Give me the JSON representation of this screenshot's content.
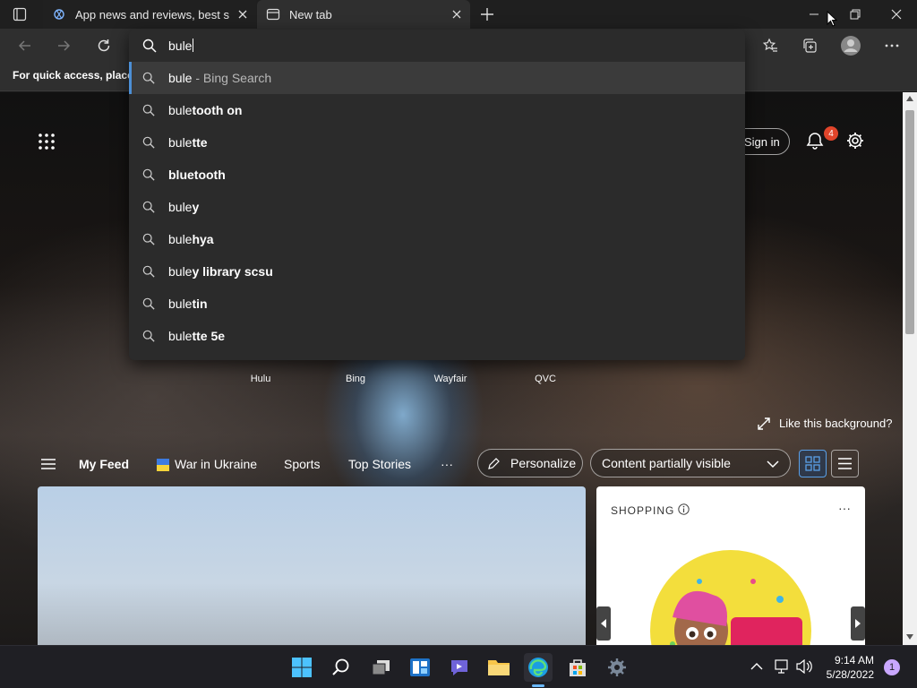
{
  "browser": {
    "tabs": [
      {
        "title": "App news and reviews, best softw",
        "active": false
      },
      {
        "title": "New tab",
        "active": true
      }
    ],
    "address_input_value": "bule",
    "favorites_hint": "For quick access, place y"
  },
  "suggestions": [
    {
      "prefix": "bule",
      "rest": "",
      "hint": " - Bing Search"
    },
    {
      "prefix": "bule",
      "rest": "tooth on",
      "hint": ""
    },
    {
      "prefix": "bule",
      "rest": "tte",
      "hint": ""
    },
    {
      "prefix": "",
      "rest": "bluetooth",
      "hint": ""
    },
    {
      "prefix": "bule",
      "rest": "y",
      "hint": ""
    },
    {
      "prefix": "bule",
      "rest": "hya",
      "hint": ""
    },
    {
      "prefix": "bule",
      "rest": "y library scsu",
      "hint": ""
    },
    {
      "prefix": "bule",
      "rest": "tin",
      "hint": ""
    },
    {
      "prefix": "bule",
      "rest": "tte 5e",
      "hint": ""
    }
  ],
  "page": {
    "sign_in": "Sign in",
    "notification_count": "4",
    "quick_links": [
      "Hulu",
      "Bing",
      "Wayfair",
      "QVC"
    ],
    "like_background": "Like this background?",
    "feed_nav": {
      "my_feed": "My Feed",
      "war": "War in Ukraine",
      "sports": "Sports",
      "top_stories": "Top Stories",
      "more": "···",
      "personalize": "Personalize",
      "content_visibility": "Content partially visible"
    },
    "shopping": {
      "title": "SHOPPING",
      "more": "···"
    }
  },
  "taskbar": {
    "time": "9:14 AM",
    "date": "5/28/2022",
    "notification_count": "1"
  },
  "colors": {
    "accent": "#4c8fd6",
    "badge": "#e1452b"
  }
}
